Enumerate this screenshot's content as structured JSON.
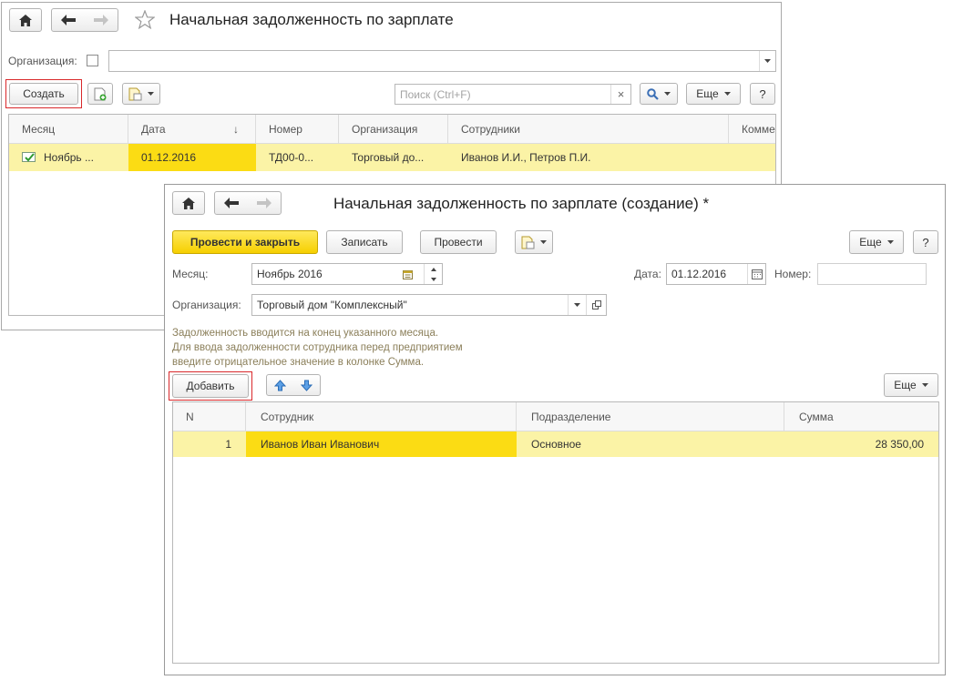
{
  "list_window": {
    "title": "Начальная задолженность по зарплате",
    "filter": {
      "label": "Организация:",
      "value": ""
    },
    "toolbar": {
      "create_label": "Создать",
      "search_placeholder": "Поиск (Ctrl+F)",
      "clear_glyph": "×",
      "more_label": "Еще",
      "help_label": "?"
    },
    "columns": [
      "Месяц",
      "Дата",
      "Номер",
      "Организация",
      "Сотрудники",
      "Комме"
    ],
    "sort_glyph": "↓",
    "rows": [
      {
        "month": "Ноябрь ...",
        "date": "01.12.2016",
        "number": "ТД00-0...",
        "org": "Торговый до...",
        "employees": "Иванов И.И., Петров П.И.",
        "comment": ""
      }
    ]
  },
  "form_window": {
    "title": "Начальная задолженность по зарплате (создание) *",
    "toolbar": {
      "post_close_label": "Провести и закрыть",
      "save_label": "Записать",
      "post_label": "Провести",
      "more_label": "Еще",
      "help_label": "?"
    },
    "month": {
      "label": "Месяц:",
      "value": "Ноябрь 2016"
    },
    "date": {
      "label": "Дата:",
      "value": "01.12.2016"
    },
    "number": {
      "label": "Номер:",
      "value": ""
    },
    "organization": {
      "label": "Организация:",
      "value": "Торговый дом \"Комплексный\""
    },
    "hint_lines": [
      "Задолженность вводится на конец указанного месяца.",
      "Для ввода задолженности сотрудника перед предприятием",
      "введите отрицательное значение в колонке Сумма."
    ],
    "table_toolbar": {
      "add_label": "Добавить",
      "more_label": "Еще"
    },
    "columns": [
      "N",
      "Сотрудник",
      "Подразделение",
      "Сумма"
    ],
    "rows": [
      {
        "n": "1",
        "employee": "Иванов Иван Иванович",
        "department": "Основное",
        "amount": "28 350,00"
      }
    ]
  },
  "colors": {
    "row_highlight": "#fbf3a6",
    "cell_selected": "#fbdc14",
    "accent_button": "#f6cf00",
    "focus_frame": "#d9282b",
    "hint_text": "#8b7f5a"
  }
}
